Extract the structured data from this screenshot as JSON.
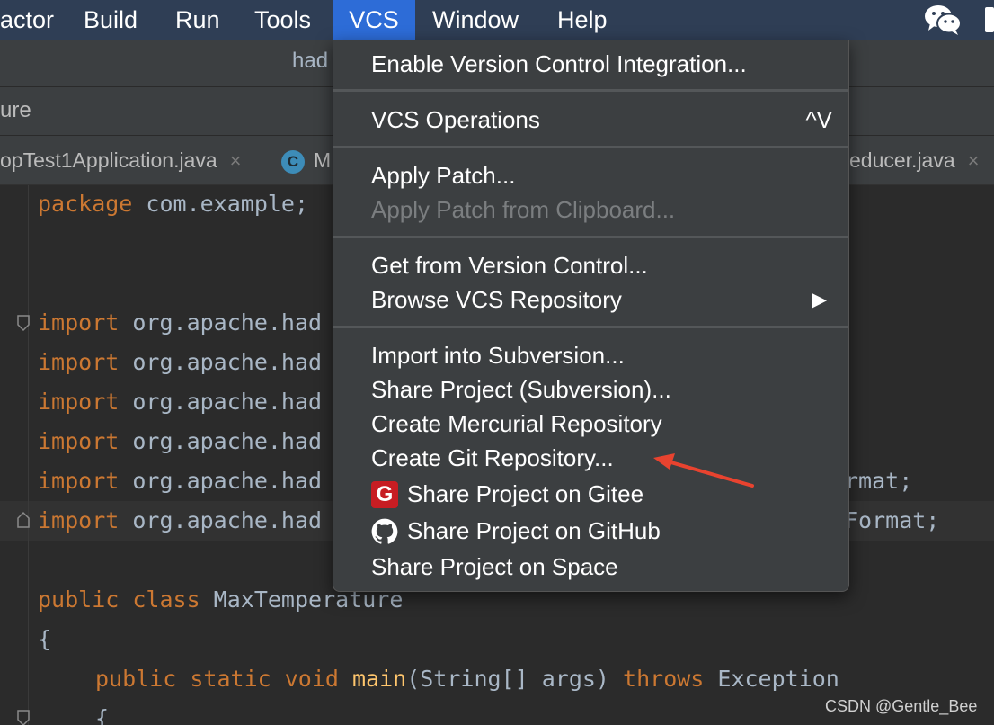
{
  "menubar": {
    "items": [
      "actor",
      "Build",
      "Run",
      "Tools",
      "VCS",
      "Window",
      "Help"
    ],
    "active": "VCS"
  },
  "window": {
    "title": "had"
  },
  "navbar": {
    "crumb": "ure"
  },
  "tabs": [
    {
      "label": "opTest1Application.java",
      "close": "×"
    },
    {
      "icon": "C",
      "label": "M"
    },
    {
      "label": "educer.java",
      "close": "×"
    }
  ],
  "editor": {
    "lines": {
      "package_kw": "package",
      "package_name": " com.example;",
      "import_kw": "import",
      "import_path": " org.apache.had",
      "import5_tail": "rmat;",
      "import6_tail": "Format;",
      "public1": "public",
      "class_kw": " class",
      "class_name": " MaxTemperature",
      "brace_open": "{",
      "public2": "public",
      "static_kw": " static",
      "void_kw": " void",
      "main_fn": " main",
      "params": "(String[] args)",
      "throws_kw": " throws",
      "exception": " Exception",
      "brace_inner": "{"
    }
  },
  "vcs_menu": {
    "enable_integration": "Enable Version Control Integration...",
    "vcs_operations": "VCS Operations",
    "vcs_operations_shortcut": "^V",
    "apply_patch": "Apply Patch...",
    "apply_patch_clipboard": "Apply Patch from Clipboard...",
    "get_from_vc": "Get from Version Control...",
    "browse_vcs_repo": "Browse VCS Repository",
    "submenu_arrow": "▶",
    "import_subversion": "Import into Subversion...",
    "share_subversion": "Share Project (Subversion)...",
    "create_mercurial": "Create Mercurial Repository",
    "create_git": "Create Git Repository...",
    "share_gitee": "Share Project on Gitee",
    "gitee_glyph": "G",
    "share_github": "Share Project on GitHub",
    "share_space": "Share Project on Space"
  },
  "annotation_color": "#e8432f",
  "watermark": "CSDN @Gentle_Bee"
}
